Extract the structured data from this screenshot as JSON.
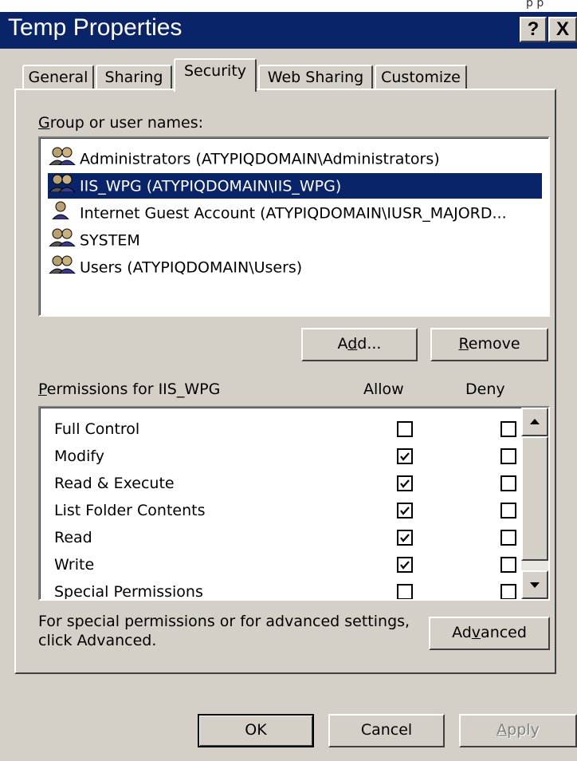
{
  "window": {
    "title": "Temp Properties",
    "help_label": "?",
    "close_label": "X"
  },
  "top_fragment": "p p",
  "tabs": [
    {
      "label": "General",
      "active": false
    },
    {
      "label": "Sharing",
      "active": false
    },
    {
      "label": "Security",
      "active": true
    },
    {
      "label": "Web Sharing",
      "active": false
    },
    {
      "label": "Customize",
      "active": false
    }
  ],
  "groups": {
    "label_prefix": "G",
    "label_rest": "roup or user names:",
    "items": [
      {
        "name": "Administrators (ATYPIQDOMAIN\\Administrators)",
        "icon": "group-icon",
        "selected": false
      },
      {
        "name": "IIS_WPG (ATYPIQDOMAIN\\IIS_WPG)",
        "icon": "group-icon",
        "selected": true
      },
      {
        "name": "Internet Guest Account (ATYPIQDOMAIN\\IUSR_MAJORD...",
        "icon": "user-icon",
        "selected": false
      },
      {
        "name": "SYSTEM",
        "icon": "group-icon",
        "selected": false
      },
      {
        "name": "Users (ATYPIQDOMAIN\\Users)",
        "icon": "group-icon",
        "selected": false
      }
    ]
  },
  "buttons": {
    "add_a": "A",
    "add_d": "d",
    "add_rest": "d...",
    "remove_r": "R",
    "remove_rest": "emove",
    "advanced_a": "Ad",
    "advanced_v": "v",
    "advanced_rest": "anced",
    "ok": "OK",
    "cancel": "Cancel",
    "apply_a": "A",
    "apply_rest": "pply"
  },
  "permissions": {
    "label_prefix": "P",
    "label_rest": "ermissions for IIS_WPG",
    "allow_header": "Allow",
    "deny_header": "Deny",
    "rows": [
      {
        "name": "Full Control",
        "allow": false,
        "deny": false
      },
      {
        "name": "Modify",
        "allow": true,
        "deny": false
      },
      {
        "name": "Read & Execute",
        "allow": true,
        "deny": false
      },
      {
        "name": "List Folder Contents",
        "allow": true,
        "deny": false
      },
      {
        "name": "Read",
        "allow": true,
        "deny": false
      },
      {
        "name": "Write",
        "allow": true,
        "deny": false
      },
      {
        "name": "Special Permissions",
        "allow": false,
        "deny": false
      }
    ]
  },
  "advanced_note": {
    "line1": "For special permissions or for advanced settings,",
    "line2": "click Advanced."
  },
  "colors": {
    "titlebar": "#0a246a",
    "face": "#d4d0c8",
    "selection": "#0a246a"
  }
}
